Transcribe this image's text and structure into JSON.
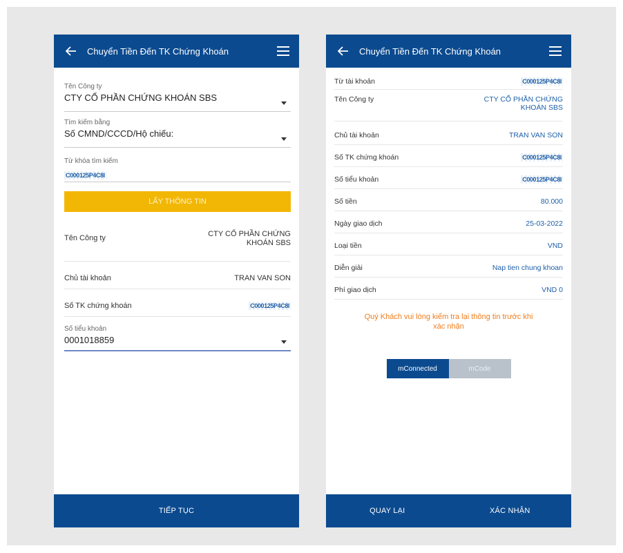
{
  "left": {
    "header": {
      "title": "Chuyển Tiền Đến TK Chứng Khoán"
    },
    "company": {
      "label": "Tên Công ty",
      "value": "CTY CỔ PHẦN CHỨNG KHOÁN SBS"
    },
    "search_by": {
      "label": "Tìm kiếm bằng",
      "value": "Số CMND/CCCD/Hộ chiếu:"
    },
    "keyword": {
      "label": "Từ khóa tìm kiếm",
      "value": "C000125P4C8I"
    },
    "get_info_label": "LẤY THÔNG TIN",
    "rows": [
      {
        "label": "Tên Công ty",
        "value": "CTY CỔ PHẦN CHỨNG KHOÁN SBS"
      },
      {
        "label": "Chủ tài khoản",
        "value": "TRAN VAN SON"
      },
      {
        "label": "Số TK chứng khoán",
        "value": "C000125P4C8I"
      }
    ],
    "sub_account": {
      "label": "Số tiểu khoản",
      "value": "0001018859"
    },
    "footer": {
      "continue_label": "TIẾP TỤC"
    }
  },
  "right": {
    "header": {
      "title": "Chuyển Tiền Đến TK Chứng Khoán"
    },
    "rows": [
      {
        "label": "Từ tài khoản",
        "value": "C000125P4C8I"
      },
      {
        "label": "Tên Công ty",
        "value": "CTY CỔ PHẦN CHỨNG KHOÁN SBS"
      },
      {
        "label": "Chủ tài khoản",
        "value": "TRAN VAN SON"
      },
      {
        "label": "Số TK chứng khoán",
        "value": "C000125P4C8I"
      },
      {
        "label": "Số tiểu khoản",
        "value": "C000125P4C8I"
      },
      {
        "label": "Số tiền",
        "value": "80.000"
      },
      {
        "label": "Ngày giao dịch",
        "value": "25-03-2022"
      },
      {
        "label": "Loại tiền",
        "value": "VND"
      },
      {
        "label": "Diễn giải",
        "value": "Nap tien chung khoan"
      },
      {
        "label": "Phí giao dịch",
        "value": "VND 0"
      }
    ],
    "notice": "Quý Khách vui lòng kiểm tra lại thông tin trước khi xác nhận",
    "auth": {
      "option_1": "mConnected",
      "option_2": "mCode",
      "selected": "mConnected"
    },
    "footer": {
      "back_label": "QUAY LẠI",
      "confirm_label": "XÁC NHẬN"
    }
  },
  "colors": {
    "primary": "#0b4a8f",
    "accent": "#f2b705",
    "notice": "#f07c1b",
    "value_blue": "#1d5fa8"
  }
}
